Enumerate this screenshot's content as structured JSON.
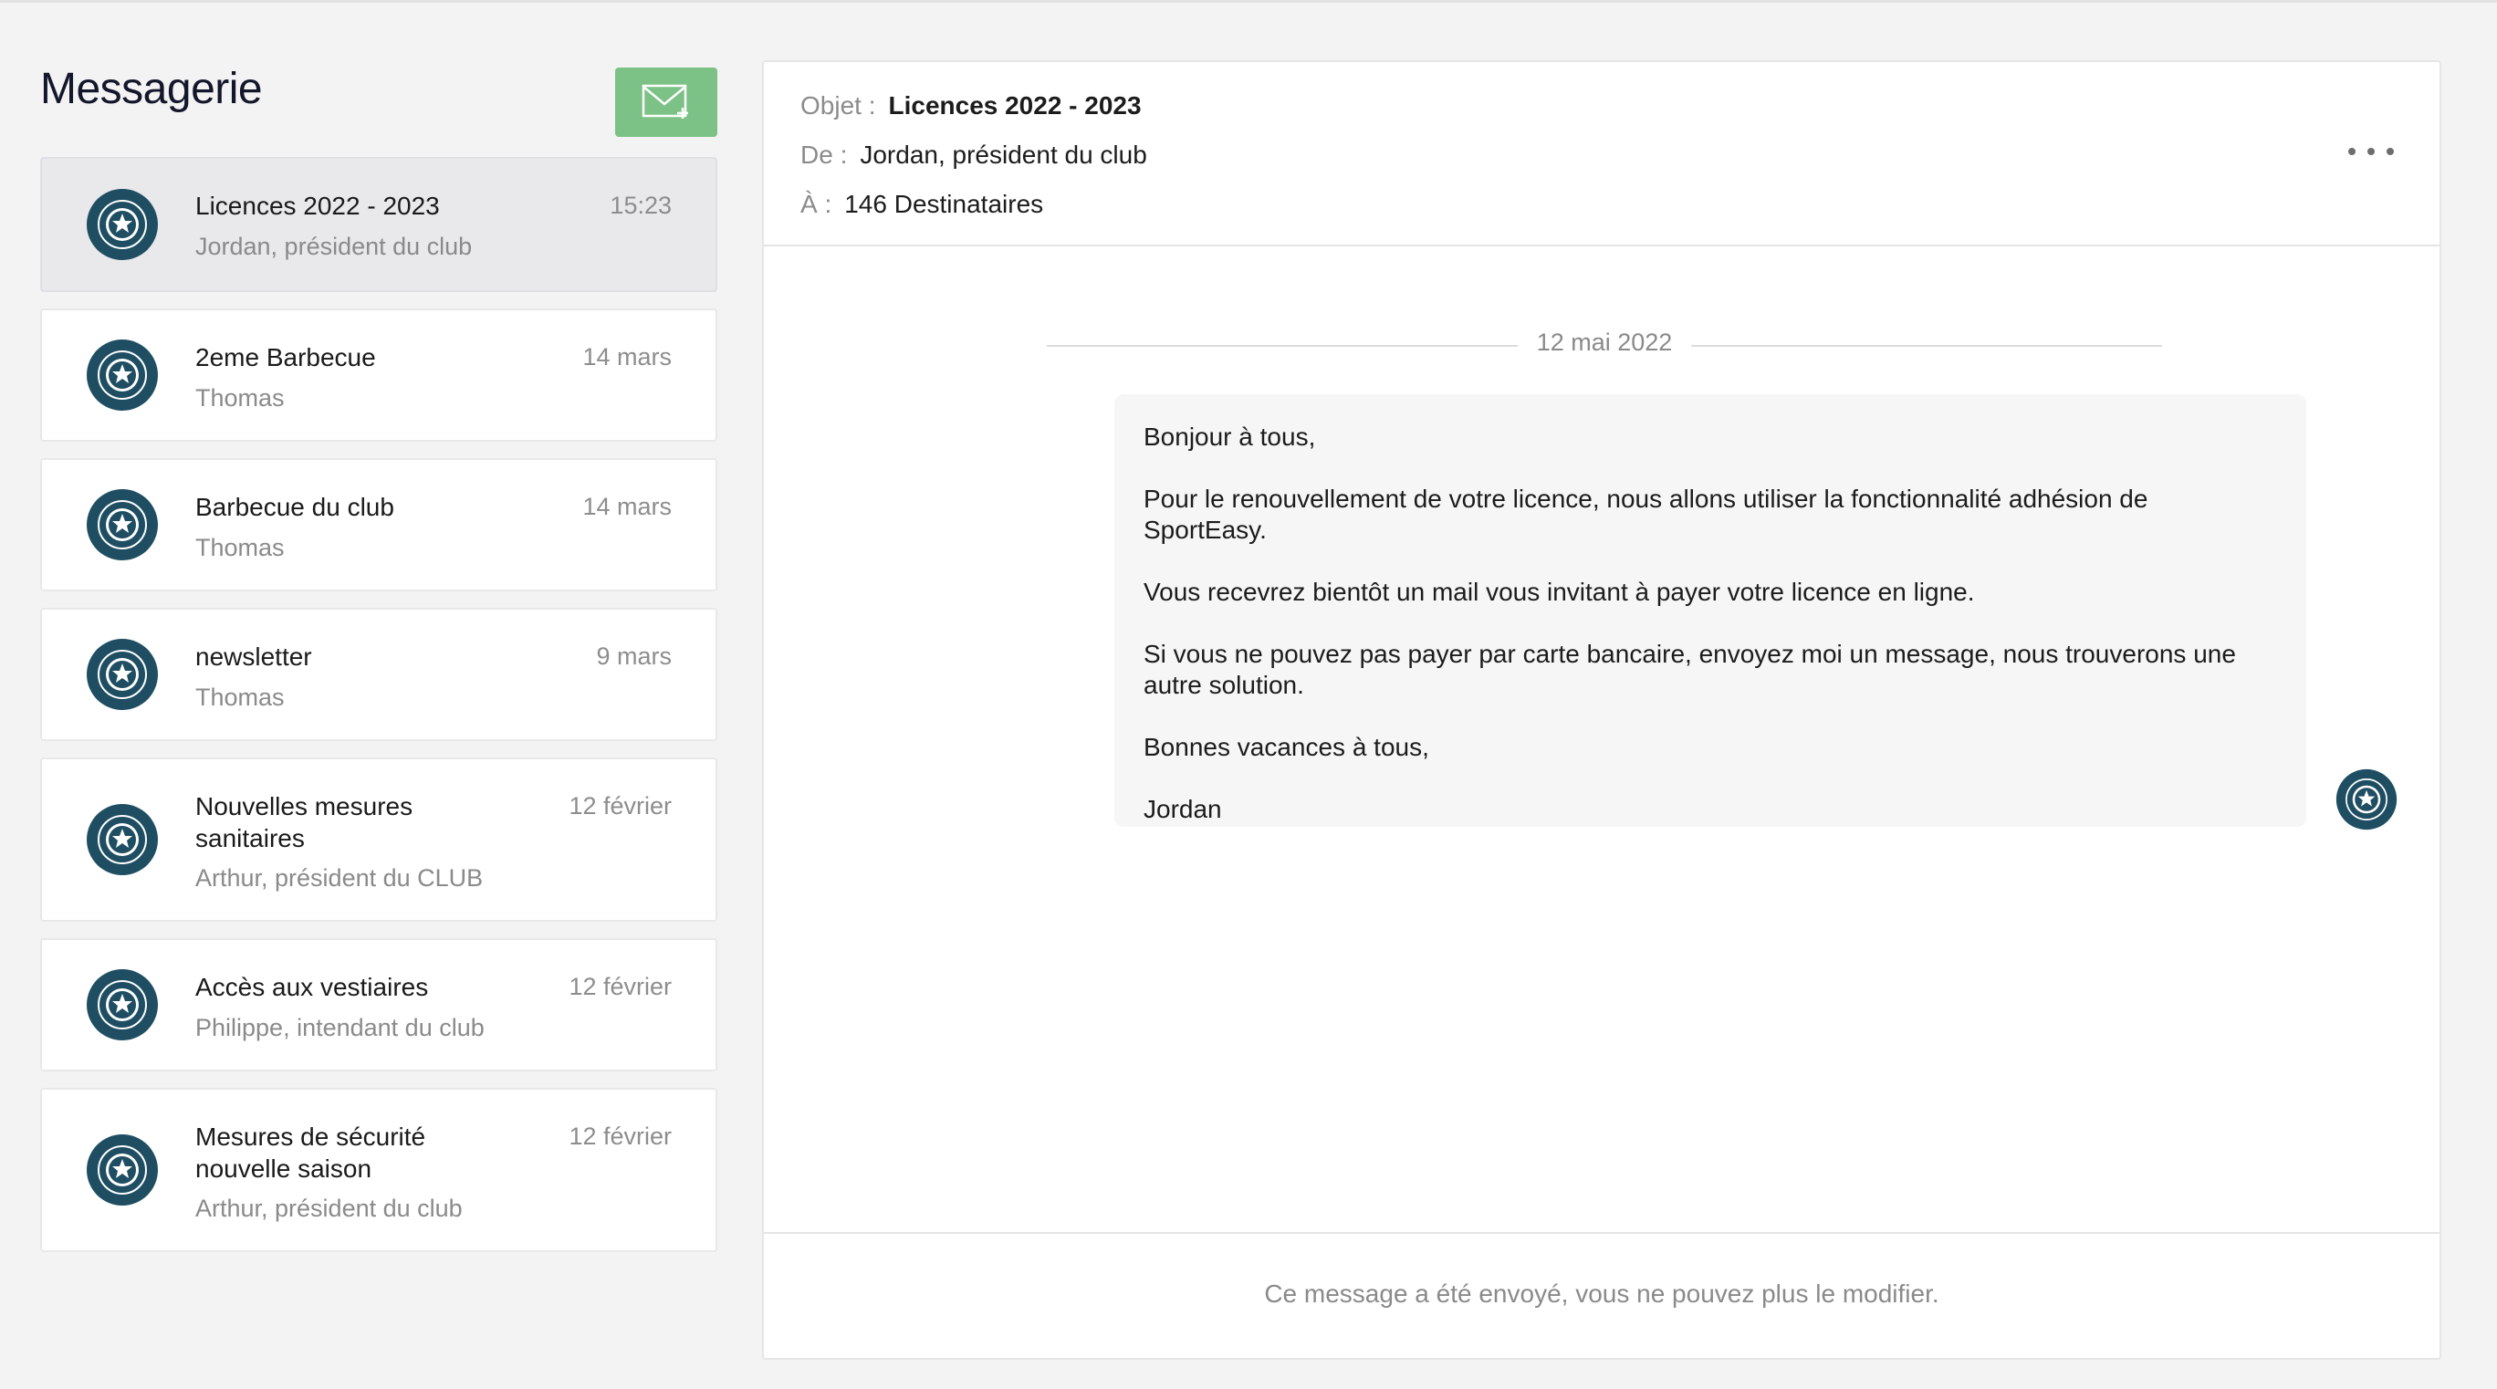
{
  "page": {
    "title": "Messagerie"
  },
  "compose": {
    "icon": "mail-compose-icon"
  },
  "conversations": [
    {
      "subject": "Licences 2022 - 2023",
      "sender": "Jordan, président du club",
      "date": "15:23",
      "selected": true
    },
    {
      "subject": "2eme Barbecue",
      "sender": "Thomas",
      "date": "14 mars"
    },
    {
      "subject": "Barbecue du club",
      "sender": "Thomas",
      "date": "14 mars"
    },
    {
      "subject": "newsletter",
      "sender": "Thomas",
      "date": "9 mars"
    },
    {
      "subject": "Nouvelles mesures sanitaires",
      "sender": "Arthur, président du CLUB",
      "date": "12 février"
    },
    {
      "subject": "Accès aux vestiaires",
      "sender": "Philippe, intendant du club",
      "date": "12 février"
    },
    {
      "subject": "Mesures de sécurité nouvelle saison",
      "sender": "Arthur, président du club",
      "date": "12 février"
    }
  ],
  "message": {
    "subject_label": "Objet :",
    "subject": "Licences 2022 - 2023",
    "from_label": "De :",
    "from": "Jordan, président du club",
    "to_label": "À :",
    "to": "146 Destinataires",
    "date": "12 mai 2022",
    "body": [
      "Bonjour à tous,",
      "Pour le renouvellement de votre licence, nous allons utiliser la fonctionnalité adhésion de SportEasy.",
      "Vous recevrez bientôt un mail vous invitant à payer votre licence en ligne.",
      "Si vous ne pouvez pas payer par carte bancaire, envoyez moi un message, nous trouverons une autre solution.",
      "Bonnes vacances à tous,",
      "Jordan"
    ],
    "footer_note": "Ce message a été envoyé, vous ne pouvez plus le modifier."
  },
  "colors": {
    "accent_green": "#7cc185",
    "club_logo": "#1f4e63",
    "selected_row": "#e9e9ec"
  }
}
